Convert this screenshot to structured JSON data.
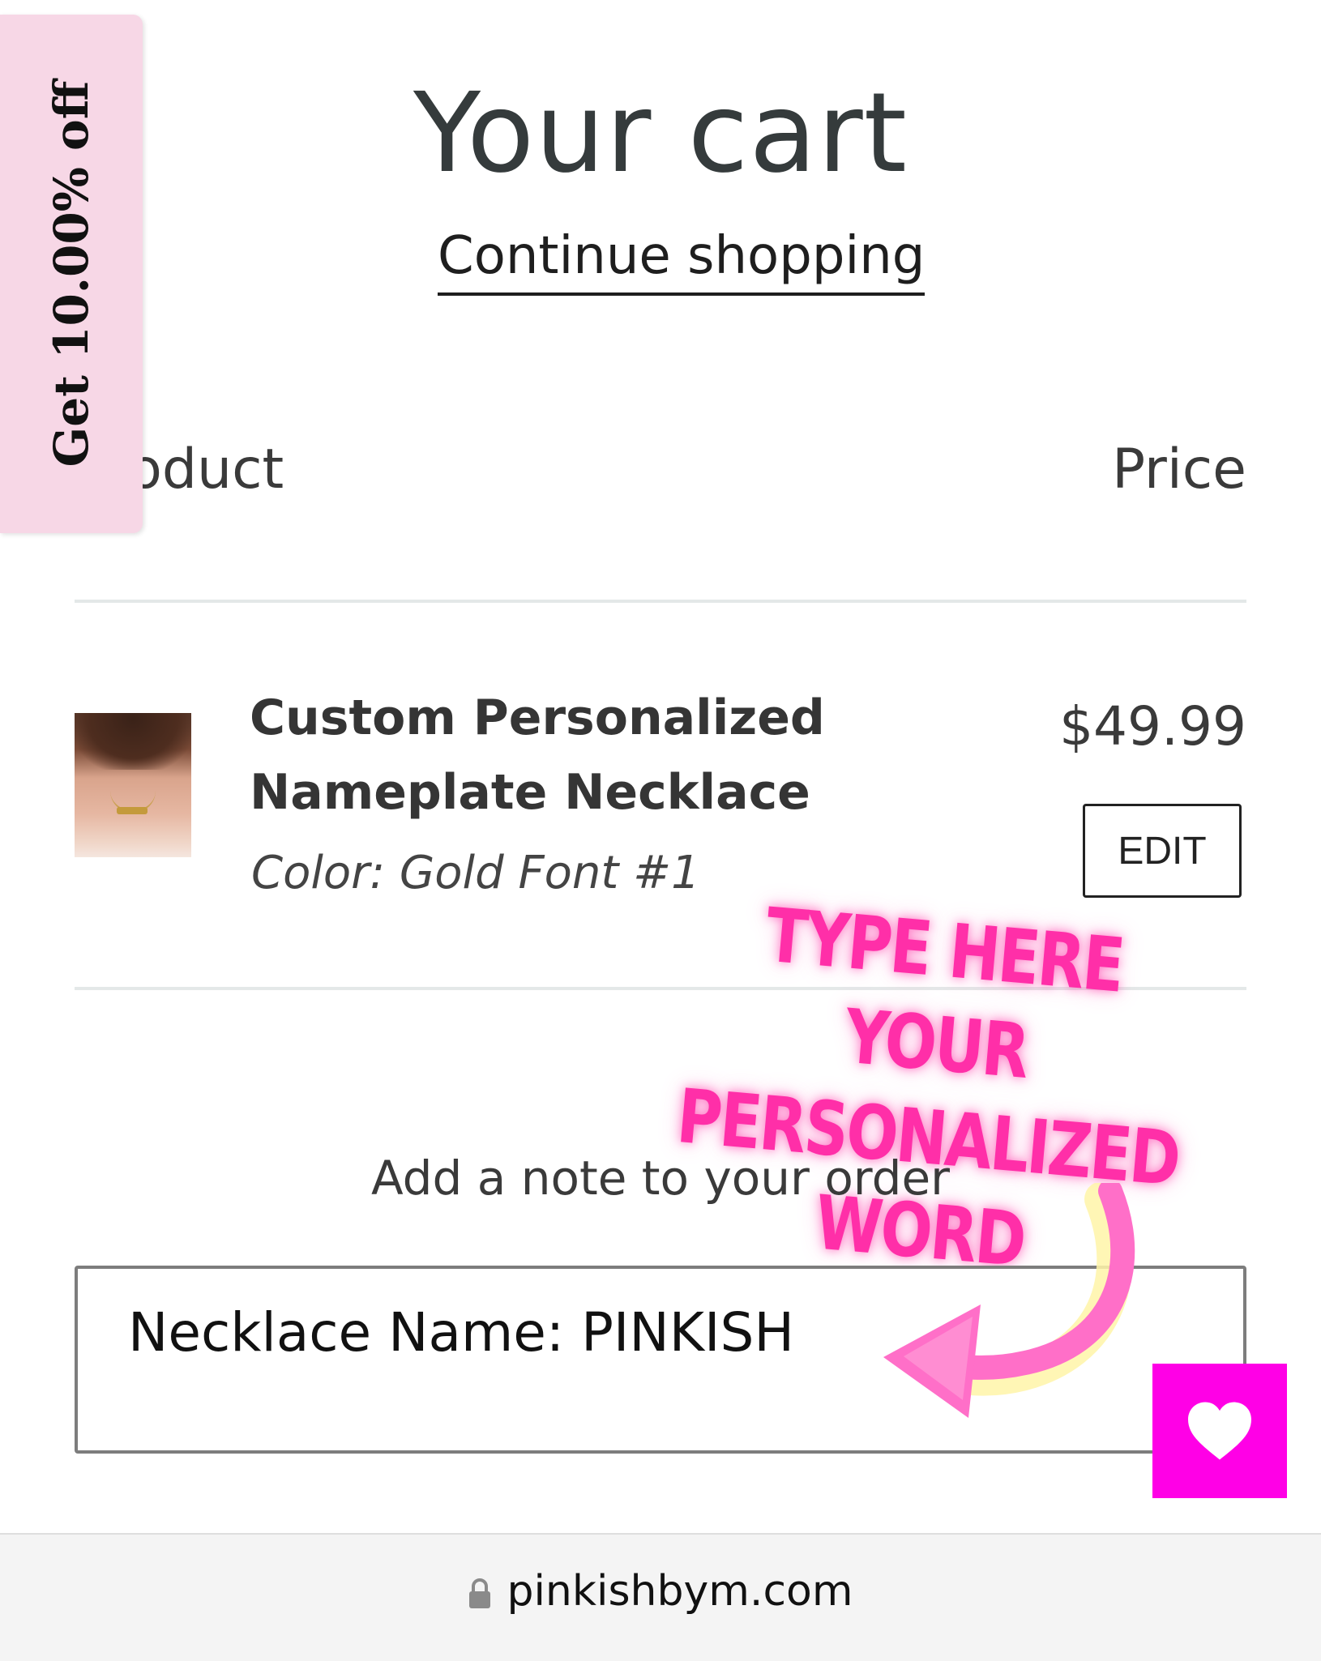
{
  "cart": {
    "title": "Your cart",
    "continue_label": "Continue shopping",
    "header_product": "Product",
    "header_price": "Price"
  },
  "item": {
    "title": "Custom Personalized Nameplate Necklace",
    "variant": "Color: Gold Font #1",
    "price": "$49.99",
    "edit_label": "EDIT"
  },
  "overlay": {
    "text": "TYPE HERE YOUR PERSONALIZED WORD",
    "color": "#ff2fa8"
  },
  "note": {
    "label": "Add a note to your order",
    "value": "Necklace Name: PINKISH"
  },
  "promo": {
    "label": "Get 10.00% off",
    "color": "#f7d7e6"
  },
  "wishlist": {
    "icon": "heart-icon",
    "color": "#ff00e6"
  },
  "browser": {
    "url": "pinkishbym.com",
    "icon": "lock-icon"
  }
}
